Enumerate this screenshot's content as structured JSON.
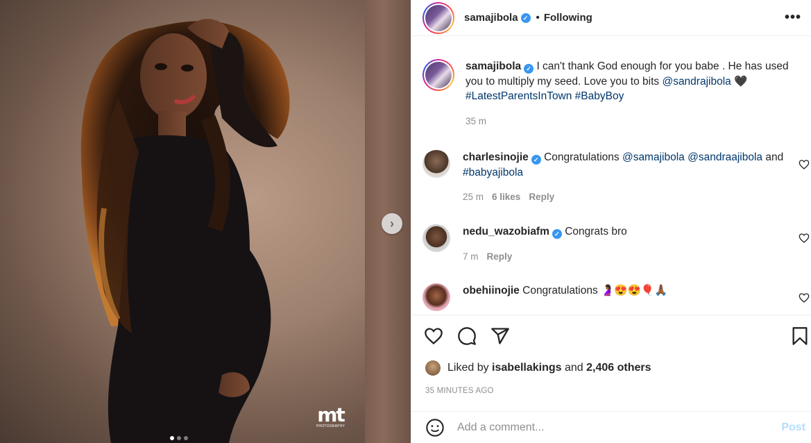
{
  "post": {
    "username": "samajibola",
    "follow_status": "Following",
    "bullet": "•",
    "more_icon": "more-horizontal-icon"
  },
  "media": {
    "watermark_logo": "mt",
    "watermark_sub": "PHOTOGRAPHY",
    "carousel_total": 3,
    "carousel_active": 1,
    "next_icon": "chevron-right-icon"
  },
  "caption": {
    "username": "samajibola",
    "text": "I can't thank God enough for you babe . He has used you to multiply my seed. Love you to bits ",
    "mention": "@sandrajibola",
    "heart": " 🖤",
    "hashtags": "#LatestParentsInTown #BabyBoy",
    "time": "35 m"
  },
  "comments": [
    {
      "username": "charlesinojie",
      "verified": true,
      "text_prefix": "Congratulations ",
      "mention1": "@samajibola",
      "mention2": "@sandraajibola",
      "mid": "and ",
      "hashtag": "#babyajibola",
      "time": "25 m",
      "likes": "6 likes",
      "reply": "Reply"
    },
    {
      "username": "nedu_wazobiafm",
      "verified": true,
      "text": "Congrats bro",
      "time": "7 m",
      "reply": "Reply"
    },
    {
      "username": "obehiinojie",
      "verified": false,
      "text": "Congratulations 🤰🏾😍😍🎈🙏🏾"
    }
  ],
  "likes": {
    "prefix": "Liked by ",
    "user": "isabellakings",
    "mid": " and ",
    "count": "2,406 others"
  },
  "timestamp": "35 MINUTES AGO",
  "composer": {
    "placeholder": "Add a comment...",
    "post_label": "Post"
  },
  "colors": {
    "link": "#00376b",
    "verified": "#3897f0",
    "post_disabled": "#b2dffc"
  }
}
